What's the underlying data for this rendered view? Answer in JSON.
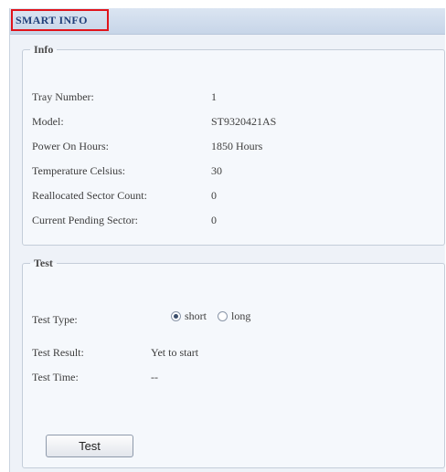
{
  "window": {
    "title": "SMART INFO"
  },
  "info": {
    "legend": "Info",
    "rows": [
      {
        "label": "Tray Number:",
        "value": "1"
      },
      {
        "label": "Model:",
        "value": "ST9320421AS"
      },
      {
        "label": "Power On Hours:",
        "value": "1850 Hours"
      },
      {
        "label": "Temperature Celsius:",
        "value": "30"
      },
      {
        "label": "Reallocated Sector Count:",
        "value": "0"
      },
      {
        "label": "Current Pending Sector:",
        "value": "0"
      }
    ]
  },
  "test": {
    "legend": "Test",
    "test_type_label": "Test Type:",
    "options": [
      {
        "label": "short",
        "selected": true
      },
      {
        "label": "long",
        "selected": false
      }
    ],
    "result_label": "Test Result:",
    "result_value": "Yet to start",
    "time_label": "Test Time:",
    "time_value": "--",
    "button_label": "Test"
  },
  "colors": {
    "title_text": "#22407a",
    "highlight_border": "#e0141b",
    "panel_bg": "#eef2f8"
  }
}
